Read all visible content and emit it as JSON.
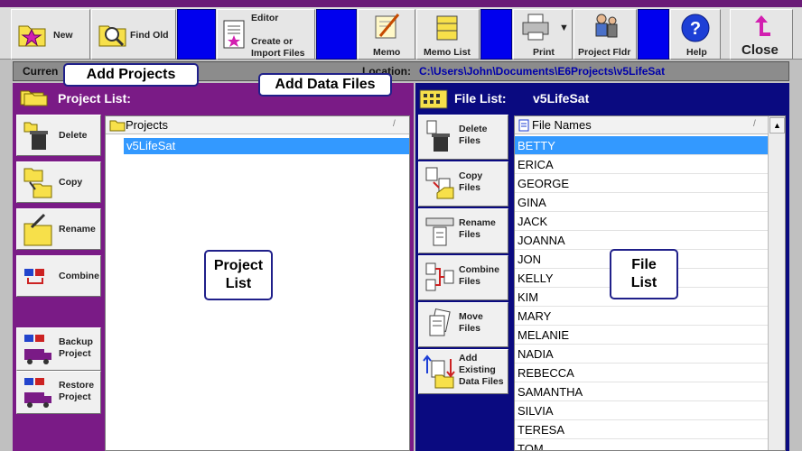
{
  "toolbar": {
    "new_label": "New",
    "find_old_label": "Find Old",
    "editor_label": "Editor",
    "create_import_label_1": "Create or",
    "create_import_label_2": "Import Files",
    "memo_label": "Memo",
    "memo_list_label": "Memo List",
    "print_label": "Print",
    "project_folder_label": "Project Fldr",
    "help_label": "Help",
    "close_label": "Close"
  },
  "location_bar": {
    "current_label": "Curren",
    "location_label": "Location:",
    "path": "C:\\Users\\John\\Documents\\E6Projects\\v5LifeSat"
  },
  "project_panel": {
    "title": "Project List:",
    "buttons": {
      "delete": "Delete",
      "copy": "Copy",
      "rename": "Rename",
      "combine": "Combine",
      "backup_1": "Backup",
      "backup_2": "Project",
      "restore_1": "Restore",
      "restore_2": "Project"
    },
    "column_header": "Projects",
    "sort_mark": "/",
    "projects": [
      "v5LifeSat"
    ]
  },
  "file_panel": {
    "title": "File List:",
    "project_name": "v5LifeSat",
    "buttons": {
      "delete_1": "Delete",
      "delete_2": "Files",
      "copy_1": "Copy",
      "copy_2": "Files",
      "rename_1": "Rename",
      "rename_2": "Files",
      "combine_1": "Combine",
      "combine_2": "Files",
      "move_1": "Move",
      "move_2": "Files",
      "add_1": "Add",
      "add_2": "Existing",
      "add_3": "Data Files"
    },
    "column_header": "File Names",
    "sort_mark": "/",
    "files": [
      "BETTY",
      "ERICA",
      "GEORGE",
      "GINA",
      "JACK",
      "JOANNA",
      "JON",
      "KELLY",
      "KIM",
      "MARY",
      "MELANIE",
      "NADIA",
      "REBECCA",
      "SAMANTHA",
      "SILVIA",
      "TERESA",
      "TOM"
    ]
  },
  "callouts": {
    "add_projects": "Add Projects",
    "add_data_files": "Add Data Files",
    "project_list_1": "Project",
    "project_list_2": "List",
    "file_list_1": "File",
    "file_list_2": "List"
  },
  "colors": {
    "project_panel": "#7a1b86",
    "file_panel": "#0a0a80",
    "selection": "#3399ff",
    "path_text": "#0000aa"
  }
}
